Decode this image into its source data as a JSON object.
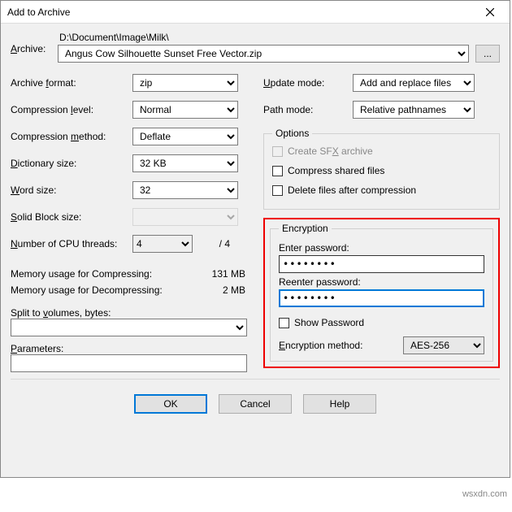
{
  "window": {
    "title": "Add to Archive"
  },
  "archive": {
    "label": "Archive:",
    "path": "D:\\Document\\Image\\Milk\\",
    "filename": "Angus Cow Silhouette Sunset Free Vector.zip",
    "browse": "..."
  },
  "left": {
    "format_label": "Archive format:",
    "format_value": "zip",
    "level_label": "Compression level:",
    "level_value": "Normal",
    "method_label": "Compression method:",
    "method_value": "Deflate",
    "dict_label": "Dictionary size:",
    "dict_value": "32 KB",
    "word_label": "Word size:",
    "word_value": "32",
    "block_label": "Solid Block size:",
    "block_value": "",
    "cpu_label": "Number of CPU threads:",
    "cpu_value": "4",
    "cpu_total": "/ 4",
    "mem_comp_label": "Memory usage for Compressing:",
    "mem_comp_value": "131 MB",
    "mem_decomp_label": "Memory usage for Decompressing:",
    "mem_decomp_value": "2 MB",
    "split_label": "Split to volumes, bytes:",
    "params_label": "Parameters:"
  },
  "right": {
    "update_label": "Update mode:",
    "update_value": "Add and replace files",
    "pathmode_label": "Path mode:",
    "pathmode_value": "Relative pathnames",
    "options_legend": "Options",
    "sfx_label": "Create SFX archive",
    "shared_label": "Compress shared files",
    "delete_label": "Delete files after compression",
    "enc_legend": "Encryption",
    "enter_pw": "Enter password:",
    "reenter_pw": "Reenter password:",
    "pw_value": "••••••••",
    "show_pw": "Show Password",
    "enc_method_label": "Encryption method:",
    "enc_method_value": "AES-256"
  },
  "buttons": {
    "ok": "OK",
    "cancel": "Cancel",
    "help": "Help"
  },
  "watermark": "wsxdn.com"
}
